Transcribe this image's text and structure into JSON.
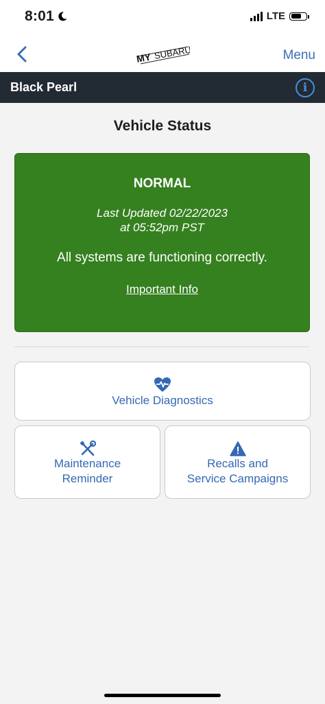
{
  "status_bar": {
    "time": "8:01",
    "network": "LTE"
  },
  "nav": {
    "back_icon": "chevron-left-icon",
    "logo_text_my": "MY",
    "logo_text_brand": "SUBARU",
    "menu_label": "Menu",
    "accent_color": "#3b6fb6"
  },
  "vehicle": {
    "name": "Black Pearl",
    "info_icon": "info-icon"
  },
  "page": {
    "title": "Vehicle Status"
  },
  "status": {
    "level": "NORMAL",
    "updated_line1": "Last Updated 02/22/2023",
    "updated_line2": "at 05:52pm PST",
    "message": "All systems are functioning correctly.",
    "info_link": "Important Info",
    "color": "#35801f"
  },
  "actions": {
    "diagnostics": {
      "icon": "heart-pulse-icon",
      "label": "Vehicle Diagnostics"
    },
    "maintenance": {
      "icon": "tools-icon",
      "label_line1": "Maintenance",
      "label_line2": "Reminder"
    },
    "recalls": {
      "icon": "warning-icon",
      "label_line1": "Recalls and",
      "label_line2": "Service Campaigns"
    }
  }
}
